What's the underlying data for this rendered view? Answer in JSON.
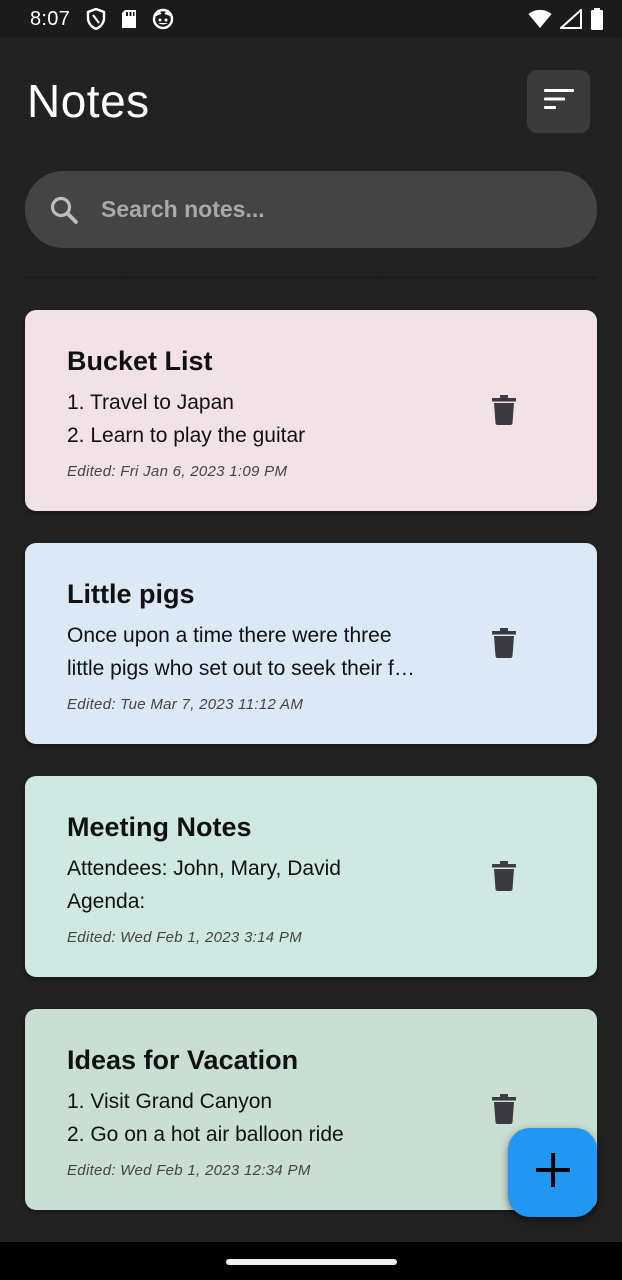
{
  "status_bar": {
    "time": "8:07",
    "left_icons": [
      "shield-icon",
      "sd-card-icon",
      "cat-face-icon"
    ],
    "right_icons": [
      "wifi-icon",
      "cell-signal-icon",
      "battery-icon"
    ]
  },
  "header": {
    "title": "Notes",
    "sort_icon": "sort-icon"
  },
  "search": {
    "placeholder": "Search notes...",
    "value": ""
  },
  "notes": [
    {
      "title": "Bucket List",
      "lines": [
        "1. Travel to Japan",
        "2. Learn to play the guitar"
      ],
      "edited": "Edited: Fri Jan 6, 2023 1:09 PM",
      "color": "#f2e1e7"
    },
    {
      "title": "Little pigs",
      "lines": [
        "Once upon a time there were three",
        "little pigs who set out to seek their f…"
      ],
      "edited": "Edited: Tue Mar 7, 2023 11:12 AM",
      "color": "#dbe8f6"
    },
    {
      "title": "Meeting Notes",
      "lines": [
        "Attendees: John, Mary, David",
        "Agenda:"
      ],
      "edited": "Edited: Wed Feb 1, 2023 3:14 PM",
      "color": "#cfe9e2"
    },
    {
      "title": "Ideas for Vacation",
      "lines": [
        "1. Visit Grand Canyon",
        "2. Go on a hot air balloon ride"
      ],
      "edited": "Edited: Wed Feb 1, 2023 12:34 PM",
      "color": "#c9dfd3"
    }
  ],
  "fab": {
    "icon": "plus-icon",
    "color": "#2196f3"
  },
  "colors": {
    "background": "#222222",
    "search_bg": "#444444",
    "sort_button_bg": "#3b3b3b",
    "delete_icon": "#3a3a40"
  }
}
